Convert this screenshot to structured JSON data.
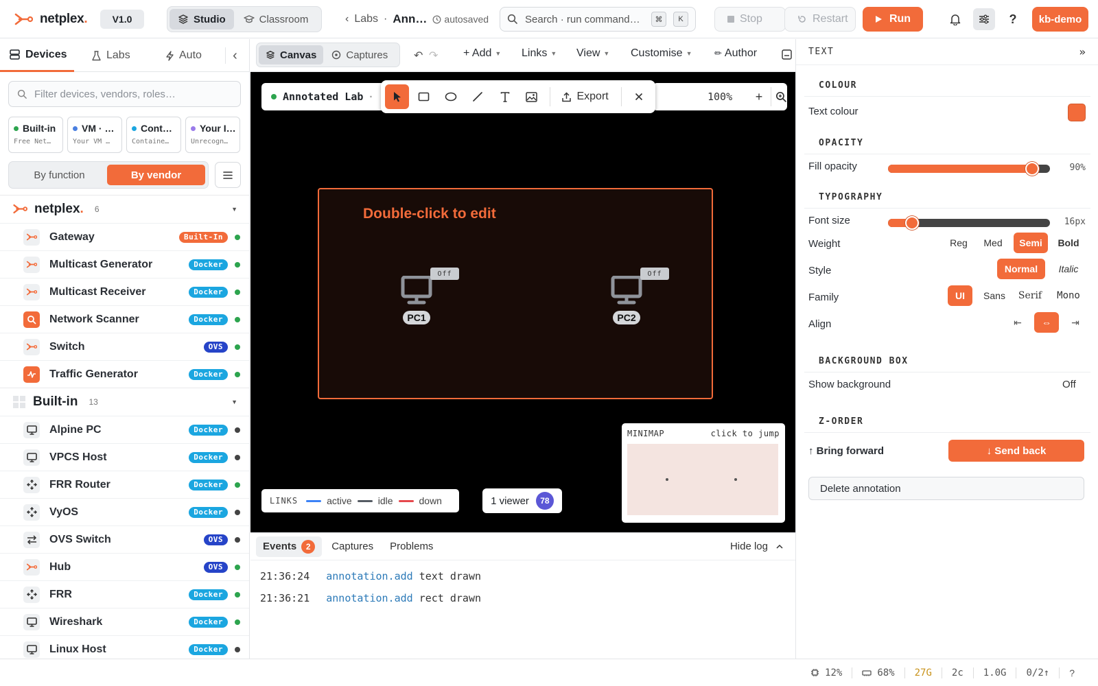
{
  "header": {
    "brand": "netplex",
    "brand_dot": ".",
    "version": "V1.0",
    "mode_tabs": [
      {
        "label": "Studio",
        "active": true
      },
      {
        "label": "Classroom",
        "active": false
      }
    ],
    "breadcrumb": {
      "parent": "Labs",
      "sep": "·",
      "current": "Ann…",
      "status": "autosaved"
    },
    "search_placeholder": "Search · run command…",
    "search_keys": [
      "⌘",
      "K"
    ],
    "stop_label": "Stop",
    "restart_label": "Restart",
    "run_label": "Run",
    "user": "kb-demo"
  },
  "sidebar": {
    "tabs": [
      {
        "label": "Devices",
        "active": true
      },
      {
        "label": "Labs",
        "active": false
      },
      {
        "label": "Auto",
        "active": false
      }
    ],
    "filter_placeholder": "Filter devices, vendors, roles…",
    "chips": [
      {
        "title": "Built-in",
        "subtitle": "Free Net…",
        "color": "#2da44e"
      },
      {
        "title": "VM · …",
        "subtitle": "Your VM …",
        "color": "#4a7fe0"
      },
      {
        "title": "Cont…",
        "subtitle": "Containe…",
        "color": "#1ba6e0"
      },
      {
        "title": "Your I…",
        "subtitle": "Unrecogn…",
        "color": "#9a7bea"
      }
    ],
    "group_by": [
      {
        "label": "By function",
        "active": false
      },
      {
        "label": "By vendor",
        "active": true
      }
    ],
    "sections": [
      {
        "title": "netplex",
        "dot": ".",
        "count": "6",
        "devices": [
          {
            "name": "Gateway",
            "badge": "Built-In",
            "kind": "builtin",
            "icon": "netplex-logo-icon",
            "status": "#2da44e"
          },
          {
            "name": "Multicast Generator",
            "badge": "Docker",
            "kind": "docker",
            "icon": "netplex-logo-icon",
            "status": "#2da44e"
          },
          {
            "name": "Multicast Receiver",
            "badge": "Docker",
            "kind": "docker",
            "icon": "netplex-logo-icon",
            "status": "#2da44e"
          },
          {
            "name": "Network Scanner",
            "badge": "Docker",
            "kind": "docker",
            "icon": "scanner-icon",
            "status": "#2da44e"
          },
          {
            "name": "Switch",
            "badge": "OVS",
            "kind": "ovs",
            "icon": "netplex-logo-icon",
            "status": "#2da44e"
          },
          {
            "name": "Traffic Generator",
            "badge": "Docker",
            "kind": "docker",
            "icon": "traffic-icon",
            "status": "#2da44e"
          }
        ]
      },
      {
        "title": "Built-in",
        "dot": "",
        "count": "13",
        "devices": [
          {
            "name": "Alpine PC",
            "badge": "Docker",
            "kind": "docker",
            "icon": "monitor-icon",
            "status": "#444"
          },
          {
            "name": "VPCS Host",
            "badge": "Docker",
            "kind": "docker",
            "icon": "monitor-icon",
            "status": "#444"
          },
          {
            "name": "FRR Router",
            "badge": "Docker",
            "kind": "docker",
            "icon": "router-icon",
            "status": "#2da44e"
          },
          {
            "name": "VyOS",
            "badge": "Docker",
            "kind": "docker",
            "icon": "router-icon",
            "status": "#444"
          },
          {
            "name": "OVS Switch",
            "badge": "OVS",
            "kind": "ovs",
            "icon": "switch-arrows-icon",
            "status": "#444"
          },
          {
            "name": "Hub",
            "badge": "OVS",
            "kind": "ovs",
            "icon": "netplex-logo-icon",
            "status": "#2da44e"
          },
          {
            "name": "FRR",
            "badge": "Docker",
            "kind": "docker",
            "icon": "router-icon",
            "status": "#2da44e"
          },
          {
            "name": "Wireshark",
            "badge": "Docker",
            "kind": "docker",
            "icon": "monitor-icon",
            "status": "#2da44e"
          },
          {
            "name": "Linux Host",
            "badge": "Docker",
            "kind": "docker",
            "icon": "monitor-icon",
            "status": "#444"
          }
        ]
      }
    ]
  },
  "canvas_toolbar": {
    "tabs": [
      {
        "label": "Canvas",
        "active": true
      },
      {
        "label": "Captures",
        "active": false
      }
    ],
    "menus": [
      "+ Add",
      "Links",
      "View",
      "Customise"
    ],
    "author_label": "Author"
  },
  "canvas": {
    "lab_name": "Annotated Lab",
    "lab_sep": "·",
    "export_label": "Export",
    "zoom": "100%",
    "annotation_text": "Double-click to edit",
    "nodes": [
      {
        "label": "PC1",
        "state": "Off"
      },
      {
        "label": "PC2",
        "state": "Off"
      }
    ],
    "links_legend": {
      "title": "LINKS",
      "items": [
        {
          "label": "active",
          "color": "#3b82f6"
        },
        {
          "label": "idle",
          "color": "#555b63"
        },
        {
          "label": "down",
          "color": "#e5484d"
        }
      ]
    },
    "viewers": {
      "label": "1 viewer",
      "count": "78"
    },
    "minimap": {
      "title": "MINIMAP",
      "hint": "click to jump"
    }
  },
  "log": {
    "tabs": [
      {
        "label": "Events",
        "badge": "2",
        "active": true
      },
      {
        "label": "Captures",
        "active": false
      },
      {
        "label": "Problems",
        "active": false
      }
    ],
    "hide_label": "Hide log",
    "entries": [
      {
        "time": "21:36:24",
        "event": "annotation.add",
        "msg": "text drawn"
      },
      {
        "time": "21:36:21",
        "event": "annotation.add",
        "msg": "rect drawn"
      }
    ]
  },
  "inspector": {
    "title": "TEXT",
    "colour_section": "COLOUR",
    "text_colour_label": "Text colour",
    "text_colour": "#f26b3a",
    "opacity_section": "OPACITY",
    "fill_opacity_label": "Fill opacity",
    "fill_opacity": 0.9,
    "fill_opacity_text": "90%",
    "typography_section": "TYPOGRAPHY",
    "font_size_label": "Font size",
    "font_size_text": "16px",
    "font_size_fraction": 0.15,
    "weight_label": "Weight",
    "weights": [
      {
        "label": "Reg",
        "active": false
      },
      {
        "label": "Med",
        "active": false
      },
      {
        "label": "Semi",
        "active": true
      },
      {
        "label": "Bold",
        "active": false
      }
    ],
    "style_label": "Style",
    "styles": [
      {
        "label": "Normal",
        "active": true
      },
      {
        "label": "Italic",
        "active": false
      }
    ],
    "family_label": "Family",
    "families": [
      {
        "label": "UI",
        "active": true
      },
      {
        "label": "Sans",
        "active": false
      },
      {
        "label": "Serif",
        "active": false
      },
      {
        "label": "Mono",
        "active": false
      }
    ],
    "align_label": "Align",
    "aligns": [
      {
        "label": "⇤",
        "active": false
      },
      {
        "label": "⇔",
        "active": true
      },
      {
        "label": "⇥",
        "active": false
      }
    ],
    "background_section": "BACKGROUND BOX",
    "show_background_label": "Show background",
    "show_background_value": "Off",
    "zorder_section": "Z-ORDER",
    "bring_forward_label": "↑ Bring forward",
    "send_back_label": "↓ Send back",
    "delete_label": "Delete annotation"
  },
  "statusbar": {
    "cpu": "12%",
    "mem": "68%",
    "disk": "27G",
    "cores": "2c",
    "net": "1.0G",
    "io": "0/2↑",
    "help": "?"
  }
}
